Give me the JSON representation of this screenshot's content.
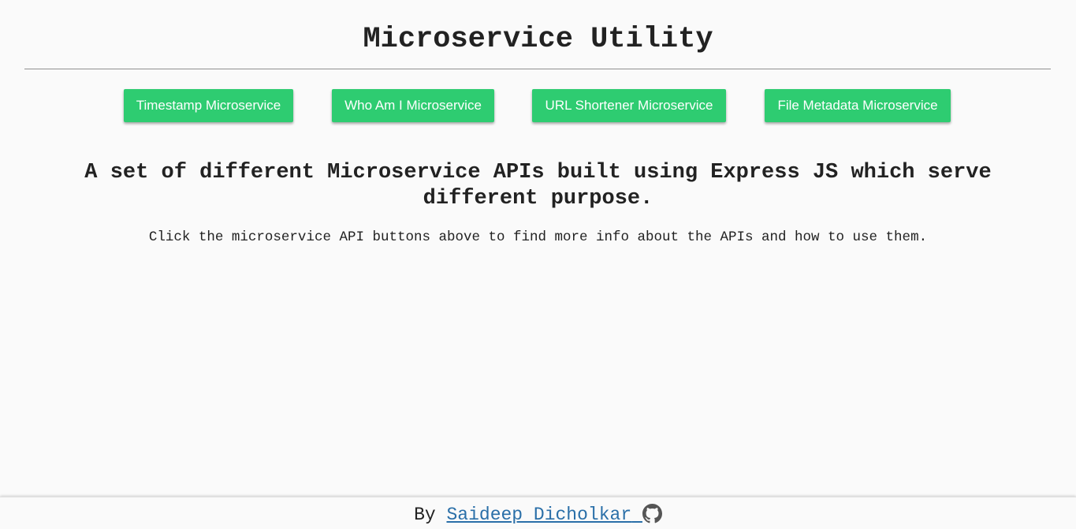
{
  "header": {
    "title": "Microservice Utility"
  },
  "nav": {
    "buttons": [
      {
        "label": "Timestamp Microservice"
      },
      {
        "label": "Who Am I Microservice"
      },
      {
        "label": "URL Shortener Microservice"
      },
      {
        "label": "File Metadata Microservice"
      }
    ]
  },
  "main": {
    "headline": "A set of different Microservice APIs built using Express JS which serve different purpose.",
    "subtext": "Click the microservice API buttons above to find more info about the APIs and how to use them."
  },
  "footer": {
    "prefix": "By",
    "author": "Saideep Dicholkar",
    "icon": "github-icon"
  },
  "colors": {
    "button_bg": "#2ecc71",
    "link": "#2a6fa8",
    "text": "#222222",
    "background": "#fafafa"
  }
}
